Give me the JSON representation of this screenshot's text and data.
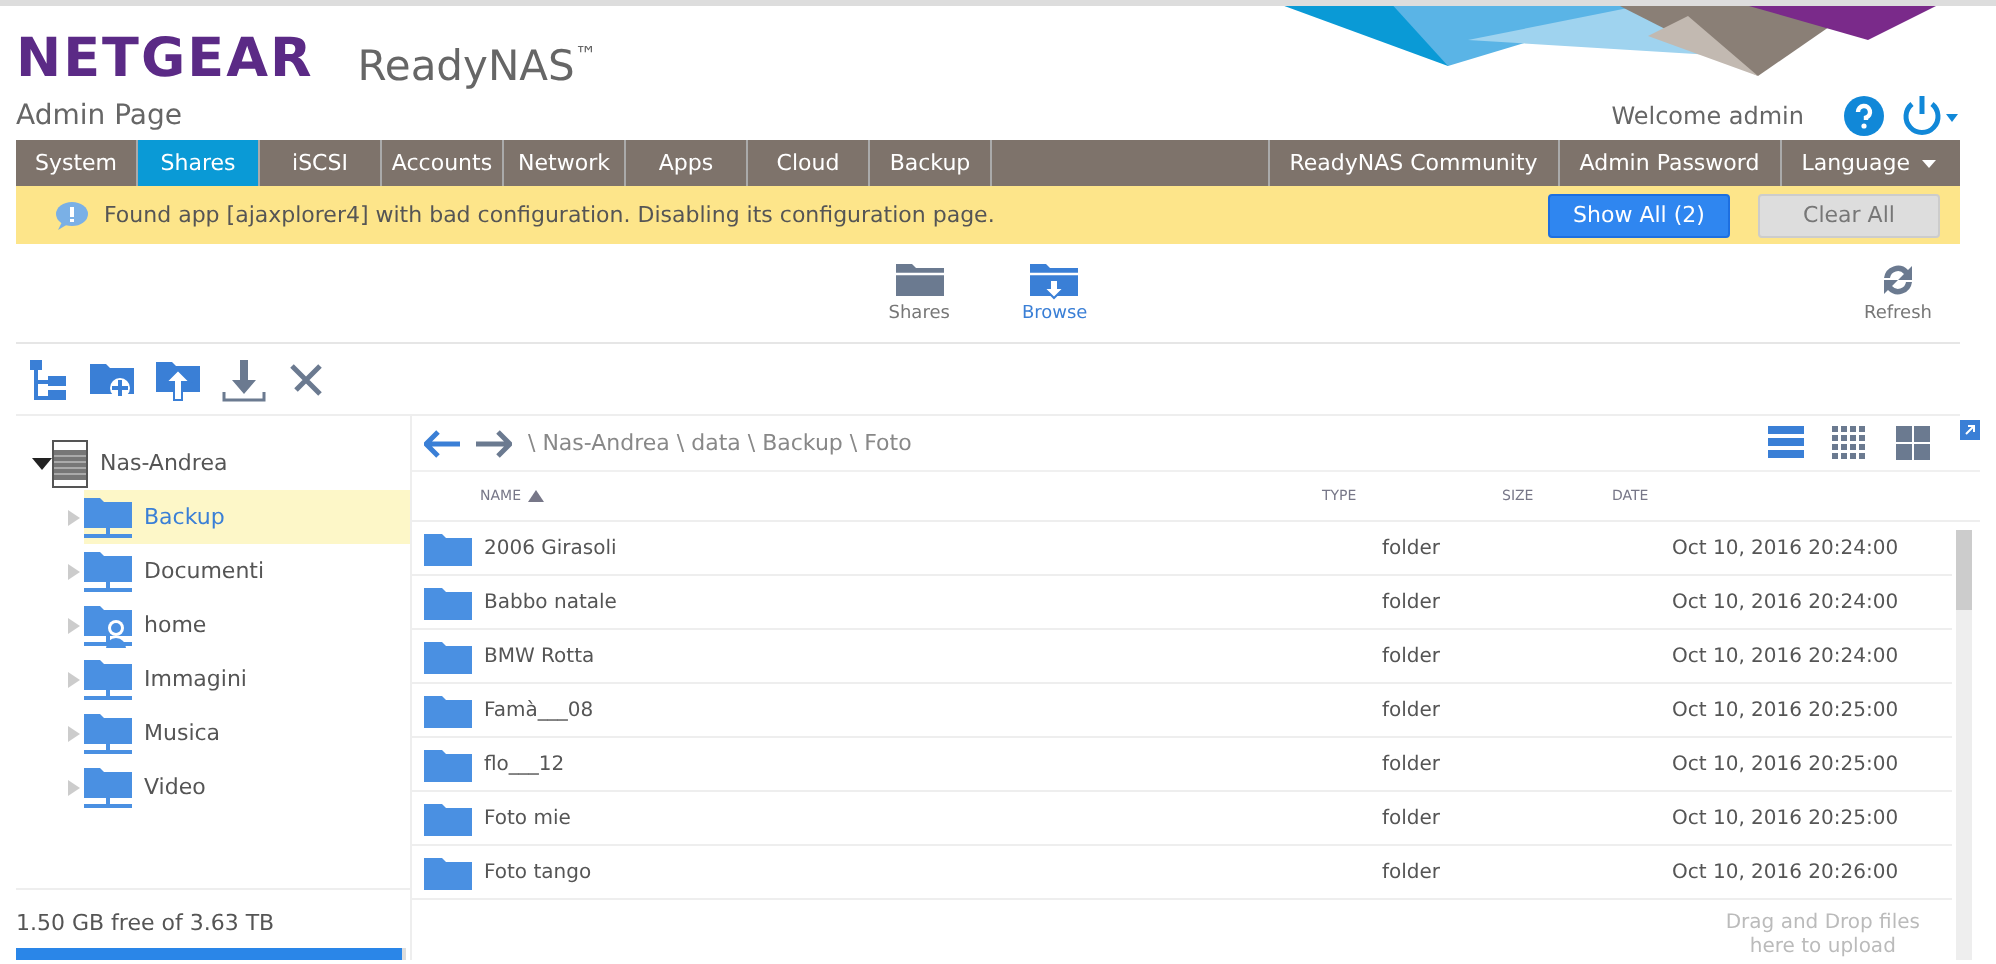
{
  "brand": {
    "logo": "NETGEAR",
    "product": "ReadyNAS",
    "trademark": "™",
    "subtitle": "Admin Page",
    "welcome": "Welcome admin"
  },
  "nav": {
    "tabs": [
      {
        "label": "System",
        "selected": false
      },
      {
        "label": "Shares",
        "selected": true
      },
      {
        "label": "iSCSI",
        "selected": false
      },
      {
        "label": "Accounts",
        "selected": false
      },
      {
        "label": "Network",
        "selected": false
      },
      {
        "label": "Apps",
        "selected": false
      },
      {
        "label": "Cloud",
        "selected": false
      },
      {
        "label": "Backup",
        "selected": false
      }
    ],
    "right_links": [
      {
        "label": "ReadyNAS Community",
        "dropdown": false
      },
      {
        "label": "Admin Password",
        "dropdown": false
      },
      {
        "label": "Language",
        "dropdown": true
      }
    ]
  },
  "notice": {
    "message": "Found app [ajaxplorer4] with bad configuration. Disabling its configuration page.",
    "buttons": [
      {
        "label": "Show All (2)",
        "kind": "primary"
      },
      {
        "label": "Clear All",
        "kind": "secondary"
      }
    ]
  },
  "subtabs": [
    {
      "label": "Shares",
      "selected": false
    },
    {
      "label": "Browse",
      "selected": true
    }
  ],
  "refresh": "Refresh",
  "tree": {
    "root": "Nas-Andrea",
    "expanded": true,
    "children": [
      {
        "label": "Backup",
        "selected": true,
        "kind": "share"
      },
      {
        "label": "Documenti",
        "selected": false,
        "kind": "share"
      },
      {
        "label": "home",
        "selected": false,
        "kind": "home"
      },
      {
        "label": "Immagini",
        "selected": false,
        "kind": "share"
      },
      {
        "label": "Musica",
        "selected": false,
        "kind": "share"
      },
      {
        "label": "Video",
        "selected": false,
        "kind": "share"
      }
    ]
  },
  "storage": {
    "text": "1.50 GB free of 3.63 TB",
    "level": 0.99
  },
  "path": "\\ Nas-Andrea \\ data \\ Backup \\ Foto",
  "views": [
    {
      "kind": "list",
      "selected": true
    },
    {
      "kind": "small",
      "selected": false
    },
    {
      "kind": "large",
      "selected": false
    }
  ],
  "table": {
    "columns": [
      "NAME",
      "TYPE",
      "SIZE",
      "DATE"
    ],
    "rows": [
      {
        "name": "2006 Girasoli",
        "type": "folder",
        "date": "Oct 10, 2016 20:24:00"
      },
      {
        "name": "Babbo natale",
        "type": "folder",
        "date": "Oct 10, 2016 20:24:00"
      },
      {
        "name": "BMW Rotta",
        "type": "folder",
        "date": "Oct 10, 2016 20:24:00"
      },
      {
        "name": "Famà___08",
        "type": "folder",
        "date": "Oct 10, 2016 20:25:00"
      },
      {
        "name": "flo___12",
        "type": "folder",
        "date": "Oct 10, 2016 20:25:00"
      },
      {
        "name": "Foto mie",
        "type": "folder",
        "date": "Oct 10, 2016 20:25:00"
      },
      {
        "name": "Foto tango",
        "type": "folder",
        "date": "Oct 10, 2016 20:26:00"
      }
    ]
  },
  "drop_hint": [
    "Drag and Drop files",
    "here to upload"
  ]
}
